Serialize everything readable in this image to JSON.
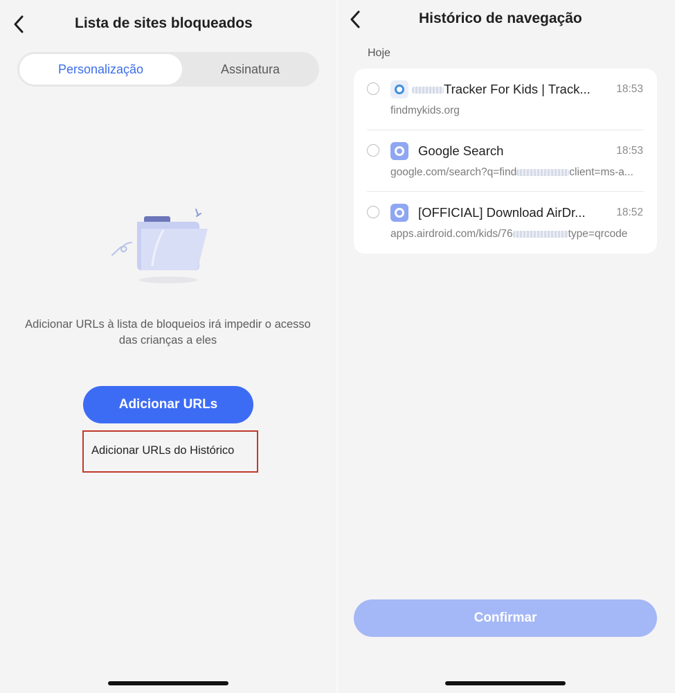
{
  "left": {
    "title": "Lista de sites bloqueados",
    "tabs": [
      {
        "label": "Personalização",
        "active": true
      },
      {
        "label": "Assinatura",
        "active": false
      }
    ],
    "empty_message": "Adicionar URLs à lista de bloqueios irá impedir o acesso das crianças a eles",
    "primary_button": "Adicionar URLs",
    "history_link": "Adicionar URLs do Histórico"
  },
  "right": {
    "title": "Histórico de navegação",
    "section": "Hoje",
    "items": [
      {
        "title": "Tracker For Kids | Track...",
        "time": "18:53",
        "url": "findmykids.org",
        "icon": "findmykids-favicon-icon"
      },
      {
        "title": "Google Search",
        "time": "18:53",
        "url_prefix": "google.com/search?q=find",
        "url_suffix": "client=ms-a...",
        "icon": "browser-globe-icon"
      },
      {
        "title": "[OFFICIAL] Download AirDr...",
        "time": "18:52",
        "url_prefix": "apps.airdroid.com/kids/76",
        "url_suffix": "type=qrcode",
        "icon": "browser-globe-icon"
      }
    ],
    "confirm_button": "Confirmar"
  },
  "colors": {
    "accent": "#3d6cf4",
    "accent_disabled": "#a4b7f6",
    "highlight_border": "#c0392b",
    "background": "#f4f4f4"
  }
}
